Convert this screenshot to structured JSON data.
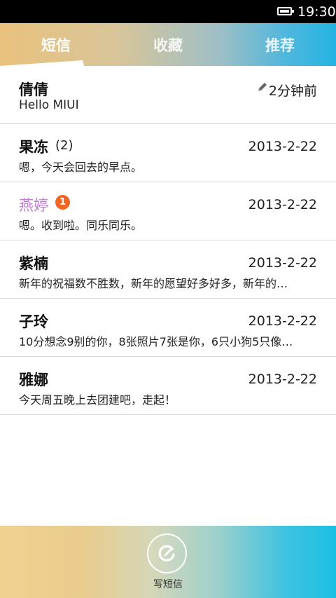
{
  "status_bar": {
    "time": "19:30",
    "icon": "battery-icon"
  },
  "tabs": [
    {
      "label": "短信",
      "active": true
    },
    {
      "label": "收藏",
      "active": false
    },
    {
      "label": "推荐",
      "active": false
    }
  ],
  "messages": [
    {
      "name": "倩倩",
      "time": "2分钟前",
      "preview": "Hello MIUI",
      "draft": true,
      "unread": false,
      "count": null
    },
    {
      "name": "果冻",
      "time": "2013-2-22",
      "preview": "嗯，今天会回去的早点。",
      "draft": false,
      "unread": false,
      "count": "(2)"
    },
    {
      "name": "燕婷",
      "time": "2013-2-22",
      "preview": "嗯。收到啦。同乐同乐。",
      "draft": false,
      "unread": true,
      "badge": "1"
    },
    {
      "name": "紫楠",
      "time": "2013-2-22",
      "preview": "新年的祝福数不胜数，新年的愿望好多好多，新年的…",
      "draft": false,
      "unread": false,
      "count": null
    },
    {
      "name": "子玲",
      "time": "2013-2-22",
      "preview": "10分想念9别的你，8张照片7张是你，6只小狗5只像…",
      "draft": false,
      "unread": false,
      "count": null
    },
    {
      "name": "雅娜",
      "time": "2013-2-22",
      "preview": "今天周五晚上去团建吧，走起！",
      "draft": false,
      "unread": false,
      "count": null
    }
  ],
  "compose": {
    "label": "写短信",
    "icon": "compose-icon"
  },
  "colors": {
    "unread_name": "#c07bd8",
    "badge": "#f26522",
    "divider": "#d8d8d8"
  }
}
